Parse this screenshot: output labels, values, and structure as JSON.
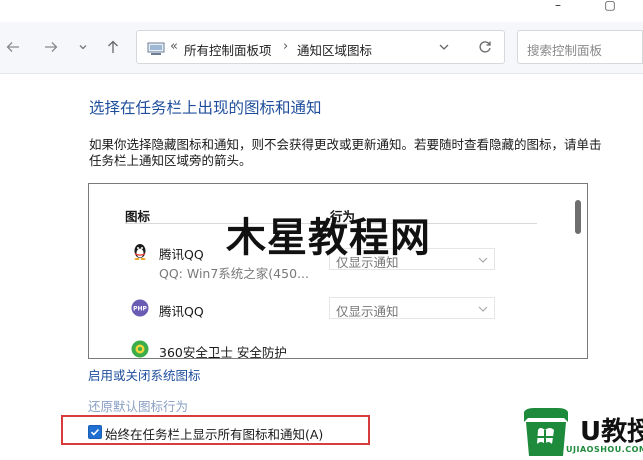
{
  "window": {
    "minimize_glyph": "–",
    "restore_glyph": "▢"
  },
  "nav": {
    "back_icon": "arrow-left-icon",
    "forward_icon": "arrow-right-icon",
    "recent_icon": "chevron-down-icon",
    "up_icon": "arrow-up-icon"
  },
  "address": {
    "overflow_glyph": "«",
    "breadcrumb": [
      "所有控制面板项",
      "通知区域图标"
    ],
    "separator": "›"
  },
  "search": {
    "placeholder": "搜索控制面板"
  },
  "content": {
    "heading": "选择在任务栏上出现的图标和通知",
    "description": "如果你选择隐藏图标和通知，则不会获得更改或更新通知。若要随时查看隐藏的图标，请单击任务栏上通知区域旁的箭头。",
    "table": {
      "col_icon": "图标",
      "col_behavior": "行为",
      "rows": [
        {
          "icon": "qq-penguin-icon",
          "name": "腾讯QQ",
          "sub": "QQ: Win7系统之家(450...",
          "behavior": "仅显示通知"
        },
        {
          "icon": "php-icon",
          "name": "腾讯QQ",
          "sub": "",
          "behavior": "仅显示通知"
        },
        {
          "icon": "360-security-icon",
          "name": "360安全卫士 安全防护",
          "sub": "",
          "behavior": ""
        }
      ]
    },
    "link_system_icons": "启用或关闭系统图标",
    "link_restore": "还原默认图标行为",
    "always_show": {
      "label": "始终在任务栏上显示所有图标和通知(A)",
      "checked": true
    }
  },
  "watermarks": {
    "center": "木星教程网",
    "logo_text": "U教授",
    "logo_url": "UJIAOSHOU.COM"
  },
  "colors": {
    "link": "#1f4e9c",
    "checkbox": "#1f6fd1",
    "highlight": "#d83b3b",
    "logo_green": "#1e8a3c"
  }
}
